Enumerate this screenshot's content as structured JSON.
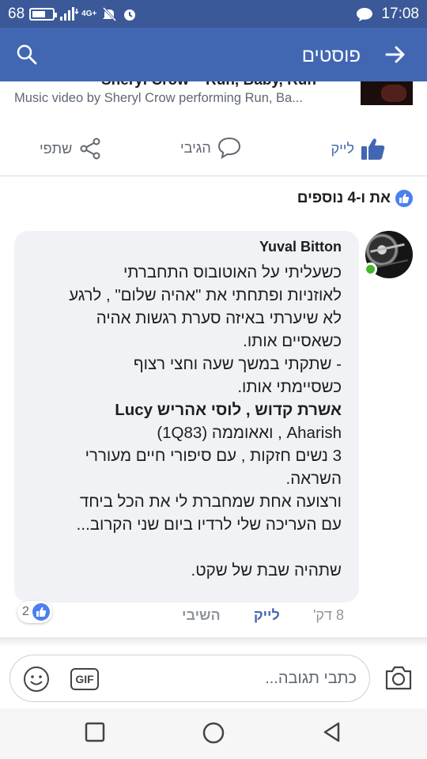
{
  "status_bar": {
    "battery_level": "68",
    "battery_fraction": 0.68,
    "network": "4G+",
    "time": "17:08",
    "icons": [
      "battery-icon",
      "signal-icon",
      "mute-icon",
      "alarm-icon",
      "message-icon"
    ]
  },
  "app_bar": {
    "title": "פוסטים",
    "icons": [
      "search-icon",
      "back-arrow-icon"
    ]
  },
  "link_preview": {
    "title_cut": "Sheryl Crow – Run, Baby, Run",
    "description": "Music video by Sheryl Crow performing Run, Ba..."
  },
  "post_actions": {
    "like": "לייק",
    "react": "הגיבי",
    "share": "שתפי"
  },
  "likers": {
    "text": "את ו-4 נוספים"
  },
  "comment": {
    "author": "Yuval Bitton",
    "lines": [
      "כשעליתי על האוטובוס התחברתי",
      "לאוזניות ופתחתי את \"אהיה שלום\" , לרגע",
      "לא שיערתי באיזה סערת רגשות אהיה",
      "כשאסיים אותו.",
      "- שתקתי במשך שעה וחצי רצוף",
      "כשסיימתי אותו.",
      "אשרת קדוש , לוסי אהריש Lucy",
      "Aharish , ואאוממה (1Q83)",
      "3 נשים חזקות , עם סיפורי חיים מעוררי",
      "השראה.",
      "ורצועה אחת שמחברת לי את הכל ביחד",
      "עם העריכה שלי לרדיו ביום שני הקרוב...",
      "",
      "שתהיה שבת של שקט."
    ],
    "reaction_count": "2",
    "time": "8 דק'",
    "like_label": "לייק",
    "reply_label": "השיבי"
  },
  "composer": {
    "placeholder": "כתבי תגובה...",
    "gif_label": "GIF",
    "icons": [
      "smiley-icon",
      "gif-icon",
      "camera-icon"
    ]
  },
  "nav_bar": {
    "icons": [
      "recent-apps-icon",
      "home-icon",
      "back-icon"
    ]
  },
  "colors": {
    "status_bar": "#3b5998",
    "app_bar": "#4267b2",
    "accent": "#4267b2",
    "comment_bg": "#f1f2f6",
    "online": "#42b72a"
  }
}
